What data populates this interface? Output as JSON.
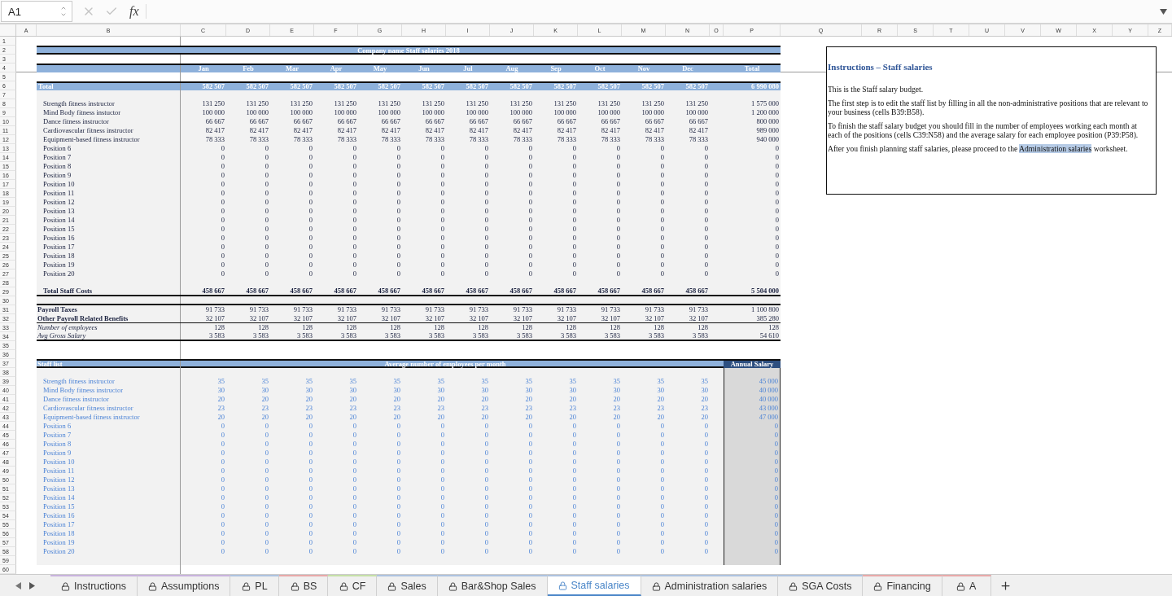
{
  "formula_bar": {
    "cell_ref": "A1",
    "fx": "fx"
  },
  "column_headers": [
    "A",
    "B",
    "C",
    "D",
    "E",
    "F",
    "G",
    "H",
    "I",
    "J",
    "K",
    "L",
    "M",
    "N",
    "O",
    "P",
    "Q",
    "R",
    "S",
    "T",
    "U",
    "V",
    "W",
    "X",
    "Y",
    "Z"
  ],
  "row_numbers": [
    "1",
    "2",
    "3",
    "4",
    "5",
    "6",
    "7",
    "8",
    "9",
    "10",
    "11",
    "12",
    "13",
    "14",
    "15",
    "16",
    "17",
    "18",
    "19",
    "20",
    "21",
    "22",
    "23",
    "24",
    "25",
    "26",
    "27",
    "28",
    "29",
    "30",
    "31",
    "32",
    "33",
    "34",
    "35",
    "36",
    "37",
    "38",
    "39",
    "40",
    "41",
    "42",
    "43",
    "44",
    "45",
    "46",
    "47",
    "48",
    "49",
    "50",
    "51",
    "52",
    "53",
    "54",
    "55",
    "56",
    "57",
    "58",
    "59",
    "60"
  ],
  "sheet": {
    "title": "Company name Staff salaries 2018",
    "months": [
      "Jan",
      "Feb",
      "Mar",
      "Apr",
      "May",
      "Jun",
      "Jul",
      "Aug",
      "Sep",
      "Oct",
      "Nov",
      "Dec"
    ],
    "total_header": "Total",
    "total_row": {
      "label": "Total",
      "values": [
        "582 507",
        "582 507",
        "582 507",
        "582 507",
        "582 507",
        "582 507",
        "582 507",
        "582 507",
        "582 507",
        "582 507",
        "582 507",
        "582 507"
      ],
      "total": "6 990 080"
    },
    "positions": [
      {
        "name": "Strength fitness instructor",
        "values": [
          "131 250",
          "131 250",
          "131 250",
          "131 250",
          "131 250",
          "131 250",
          "131 250",
          "131 250",
          "131 250",
          "131 250",
          "131 250",
          "131 250"
        ],
        "total": "1 575 000"
      },
      {
        "name": "Mind Body fitness instuctor",
        "values": [
          "100 000",
          "100 000",
          "100 000",
          "100 000",
          "100 000",
          "100 000",
          "100 000",
          "100 000",
          "100 000",
          "100 000",
          "100 000",
          "100 000"
        ],
        "total": "1 200 000"
      },
      {
        "name": "Dance fitness instructor",
        "values": [
          "66 667",
          "66 667",
          "66 667",
          "66 667",
          "66 667",
          "66 667",
          "66 667",
          "66 667",
          "66 667",
          "66 667",
          "66 667",
          "66 667"
        ],
        "total": "800 000"
      },
      {
        "name": "Cardiovascular fitness instructor",
        "values": [
          "82 417",
          "82 417",
          "82 417",
          "82 417",
          "82 417",
          "82 417",
          "82 417",
          "82 417",
          "82 417",
          "82 417",
          "82 417",
          "82 417"
        ],
        "total": "989 000"
      },
      {
        "name": "Equipment-based fitness instructor",
        "values": [
          "78 333",
          "78 333",
          "78 333",
          "78 333",
          "78 333",
          "78 333",
          "78 333",
          "78 333",
          "78 333",
          "78 333",
          "78 333",
          "78 333"
        ],
        "total": "940 000"
      },
      {
        "name": "Position 6",
        "values": [
          "0",
          "0",
          "0",
          "0",
          "0",
          "0",
          "0",
          "0",
          "0",
          "0",
          "0",
          "0"
        ],
        "total": "0"
      },
      {
        "name": "Position 7",
        "values": [
          "0",
          "0",
          "0",
          "0",
          "0",
          "0",
          "0",
          "0",
          "0",
          "0",
          "0",
          "0"
        ],
        "total": "0"
      },
      {
        "name": "Position 8",
        "values": [
          "0",
          "0",
          "0",
          "0",
          "0",
          "0",
          "0",
          "0",
          "0",
          "0",
          "0",
          "0"
        ],
        "total": "0"
      },
      {
        "name": "Position 9",
        "values": [
          "0",
          "0",
          "0",
          "0",
          "0",
          "0",
          "0",
          "0",
          "0",
          "0",
          "0",
          "0"
        ],
        "total": "0"
      },
      {
        "name": "Position 10",
        "values": [
          "0",
          "0",
          "0",
          "0",
          "0",
          "0",
          "0",
          "0",
          "0",
          "0",
          "0",
          "0"
        ],
        "total": "0"
      },
      {
        "name": "Position 11",
        "values": [
          "0",
          "0",
          "0",
          "0",
          "0",
          "0",
          "0",
          "0",
          "0",
          "0",
          "0",
          "0"
        ],
        "total": "0"
      },
      {
        "name": "Position 12",
        "values": [
          "0",
          "0",
          "0",
          "0",
          "0",
          "0",
          "0",
          "0",
          "0",
          "0",
          "0",
          "0"
        ],
        "total": "0"
      },
      {
        "name": "Position 13",
        "values": [
          "0",
          "0",
          "0",
          "0",
          "0",
          "0",
          "0",
          "0",
          "0",
          "0",
          "0",
          "0"
        ],
        "total": "0"
      },
      {
        "name": "Position 14",
        "values": [
          "0",
          "0",
          "0",
          "0",
          "0",
          "0",
          "0",
          "0",
          "0",
          "0",
          "0",
          "0"
        ],
        "total": "0"
      },
      {
        "name": "Position 15",
        "values": [
          "0",
          "0",
          "0",
          "0",
          "0",
          "0",
          "0",
          "0",
          "0",
          "0",
          "0",
          "0"
        ],
        "total": "0"
      },
      {
        "name": "Position 16",
        "values": [
          "0",
          "0",
          "0",
          "0",
          "0",
          "0",
          "0",
          "0",
          "0",
          "0",
          "0",
          "0"
        ],
        "total": "0"
      },
      {
        "name": "Position 17",
        "values": [
          "0",
          "0",
          "0",
          "0",
          "0",
          "0",
          "0",
          "0",
          "0",
          "0",
          "0",
          "0"
        ],
        "total": "0"
      },
      {
        "name": "Position 18",
        "values": [
          "0",
          "0",
          "0",
          "0",
          "0",
          "0",
          "0",
          "0",
          "0",
          "0",
          "0",
          "0"
        ],
        "total": "0"
      },
      {
        "name": "Position 19",
        "values": [
          "0",
          "0",
          "0",
          "0",
          "0",
          "0",
          "0",
          "0",
          "0",
          "0",
          "0",
          "0"
        ],
        "total": "0"
      },
      {
        "name": "Position 20",
        "values": [
          "0",
          "0",
          "0",
          "0",
          "0",
          "0",
          "0",
          "0",
          "0",
          "0",
          "0",
          "0"
        ],
        "total": "0"
      }
    ],
    "total_staff_costs": {
      "label": "Total Staff Costs",
      "values": [
        "458 667",
        "458 667",
        "458 667",
        "458 667",
        "458 667",
        "458 667",
        "458 667",
        "458 667",
        "458 667",
        "458 667",
        "458 667",
        "458 667"
      ],
      "total": "5 504 000"
    },
    "summary": [
      {
        "kind": "bold",
        "label": "Payroll Taxes",
        "values": [
          "91 733",
          "91 733",
          "91 733",
          "91 733",
          "91 733",
          "91 733",
          "91 733",
          "91 733",
          "91 733",
          "91 733",
          "91 733",
          "91 733"
        ],
        "total": "1 100 800"
      },
      {
        "kind": "bold",
        "label": "Other Payroll Related Benefits",
        "values": [
          "32 107",
          "32 107",
          "32 107",
          "32 107",
          "32 107",
          "32 107",
          "32 107",
          "32 107",
          "32 107",
          "32 107",
          "32 107",
          "32 107"
        ],
        "total": "385 280"
      },
      {
        "kind": "italic",
        "label": "Number of employees",
        "values": [
          "128",
          "128",
          "128",
          "128",
          "128",
          "128",
          "128",
          "128",
          "128",
          "128",
          "128",
          "128"
        ],
        "total": "128"
      },
      {
        "kind": "italic",
        "label": "Avg Gross Salary",
        "values": [
          "3 583",
          "3 583",
          "3 583",
          "3 583",
          "3 583",
          "3 583",
          "3 583",
          "3 583",
          "3 583",
          "3 583",
          "3 583",
          "3 583"
        ],
        "total": "54 610"
      }
    ],
    "staff_list": {
      "label": "Staff list",
      "header": "Average number of employees per month",
      "salary_header": "Annual Salary",
      "rows": [
        {
          "name": "Strength fitness instructor",
          "values": [
            "35",
            "35",
            "35",
            "35",
            "35",
            "35",
            "35",
            "35",
            "35",
            "35",
            "35",
            "35"
          ],
          "salary": "45 000"
        },
        {
          "name": "Mind Body fitness instructor",
          "values": [
            "30",
            "30",
            "30",
            "30",
            "30",
            "30",
            "30",
            "30",
            "30",
            "30",
            "30",
            "30"
          ],
          "salary": "40 000"
        },
        {
          "name": "Dance fitness instructor",
          "values": [
            "20",
            "20",
            "20",
            "20",
            "20",
            "20",
            "20",
            "20",
            "20",
            "20",
            "20",
            "20"
          ],
          "salary": "40 000"
        },
        {
          "name": "Cardiovascular fitness instructor",
          "values": [
            "23",
            "23",
            "23",
            "23",
            "23",
            "23",
            "23",
            "23",
            "23",
            "23",
            "23",
            "23"
          ],
          "salary": "43 000"
        },
        {
          "name": "Equipment-based fitness instructor",
          "values": [
            "20",
            "20",
            "20",
            "20",
            "20",
            "20",
            "20",
            "20",
            "20",
            "20",
            "20",
            "20"
          ],
          "salary": "47 000"
        },
        {
          "name": "Position 6",
          "values": [
            "0",
            "0",
            "0",
            "0",
            "0",
            "0",
            "0",
            "0",
            "0",
            "0",
            "0",
            "0"
          ],
          "salary": "0"
        },
        {
          "name": "Position 7",
          "values": [
            "0",
            "0",
            "0",
            "0",
            "0",
            "0",
            "0",
            "0",
            "0",
            "0",
            "0",
            "0"
          ],
          "salary": "0"
        },
        {
          "name": "Position 8",
          "values": [
            "0",
            "0",
            "0",
            "0",
            "0",
            "0",
            "0",
            "0",
            "0",
            "0",
            "0",
            "0"
          ],
          "salary": "0"
        },
        {
          "name": "Position 9",
          "values": [
            "0",
            "0",
            "0",
            "0",
            "0",
            "0",
            "0",
            "0",
            "0",
            "0",
            "0",
            "0"
          ],
          "salary": "0"
        },
        {
          "name": "Position 10",
          "values": [
            "0",
            "0",
            "0",
            "0",
            "0",
            "0",
            "0",
            "0",
            "0",
            "0",
            "0",
            "0"
          ],
          "salary": "0"
        },
        {
          "name": "Position 11",
          "values": [
            "0",
            "0",
            "0",
            "0",
            "0",
            "0",
            "0",
            "0",
            "0",
            "0",
            "0",
            "0"
          ],
          "salary": "0"
        },
        {
          "name": "Position 12",
          "values": [
            "0",
            "0",
            "0",
            "0",
            "0",
            "0",
            "0",
            "0",
            "0",
            "0",
            "0",
            "0"
          ],
          "salary": "0"
        },
        {
          "name": "Position 13",
          "values": [
            "0",
            "0",
            "0",
            "0",
            "0",
            "0",
            "0",
            "0",
            "0",
            "0",
            "0",
            "0"
          ],
          "salary": "0"
        },
        {
          "name": "Position 14",
          "values": [
            "0",
            "0",
            "0",
            "0",
            "0",
            "0",
            "0",
            "0",
            "0",
            "0",
            "0",
            "0"
          ],
          "salary": "0"
        },
        {
          "name": "Position 15",
          "values": [
            "0",
            "0",
            "0",
            "0",
            "0",
            "0",
            "0",
            "0",
            "0",
            "0",
            "0",
            "0"
          ],
          "salary": "0"
        },
        {
          "name": "Position 16",
          "values": [
            "0",
            "0",
            "0",
            "0",
            "0",
            "0",
            "0",
            "0",
            "0",
            "0",
            "0",
            "0"
          ],
          "salary": "0"
        },
        {
          "name": "Position 17",
          "values": [
            "0",
            "0",
            "0",
            "0",
            "0",
            "0",
            "0",
            "0",
            "0",
            "0",
            "0",
            "0"
          ],
          "salary": "0"
        },
        {
          "name": "Position 18",
          "values": [
            "0",
            "0",
            "0",
            "0",
            "0",
            "0",
            "0",
            "0",
            "0",
            "0",
            "0",
            "0"
          ],
          "salary": "0"
        },
        {
          "name": "Position 19",
          "values": [
            "0",
            "0",
            "0",
            "0",
            "0",
            "0",
            "0",
            "0",
            "0",
            "0",
            "0",
            "0"
          ],
          "salary": "0"
        },
        {
          "name": "Position 20",
          "values": [
            "0",
            "0",
            "0",
            "0",
            "0",
            "0",
            "0",
            "0",
            "0",
            "0",
            "0",
            "0"
          ],
          "salary": "0"
        }
      ]
    }
  },
  "instructions": {
    "title": "Instructions – Staff salaries",
    "paragraphs": [
      {
        "text": "This is the Staff salary budget."
      },
      {
        "text": "The first step is to edit the staff list by filling in all the non-administrative positions that are relevant to your business (cells B39:B58)."
      },
      {
        "text": "To finish the staff salary budget you should fill in the number of employees working each month at each of the positions (cells C39:N58) and the average salary for each employee position (P39:P58)."
      },
      {
        "text": "After you finish planning staff salaries, please proceed to the ",
        "highlight": "Administration salaries",
        "after": " worksheet."
      }
    ]
  },
  "tabs": [
    {
      "label": "Instructions",
      "selected": false,
      "color": "#c9b3dd"
    },
    {
      "label": "Assumptions",
      "selected": false,
      "color": "#c9b3dd"
    },
    {
      "label": "PL",
      "selected": false,
      "color": "#aec3e0"
    },
    {
      "label": "BS",
      "selected": false,
      "color": "#e8a9a9"
    },
    {
      "label": "CF",
      "selected": false,
      "color": "#c6e0a8"
    },
    {
      "label": "Sales",
      "selected": false,
      "color": "#aec3e0"
    },
    {
      "label": "Bar&Shop Sales",
      "selected": false,
      "color": "#aec3e0"
    },
    {
      "label": "Staff salaries",
      "selected": true,
      "color": "#aec3e0"
    },
    {
      "label": "Administration salaries",
      "selected": false,
      "color": "#aec3e0"
    },
    {
      "label": "SGA Costs",
      "selected": false,
      "color": "#aec3e0"
    },
    {
      "label": "Financing",
      "selected": false,
      "color": "#e8a9a9"
    },
    {
      "label": "A",
      "selected": false,
      "color": "#e8a9a9"
    }
  ]
}
